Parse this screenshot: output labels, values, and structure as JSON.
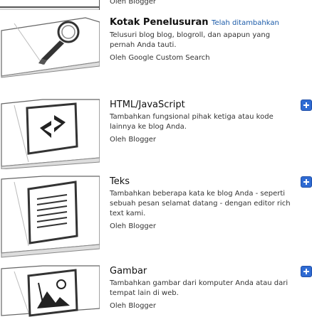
{
  "header": {
    "partial_text": "Oleh Blogger"
  },
  "gadgets": [
    {
      "title": "Kotak Penelusuran",
      "title_suffix": "Telah ditambahkan",
      "description": "Telusuri blog blog, blogroll, dan apapun yang pernah Anda tauti.",
      "byline": "Oleh Google Custom Search",
      "icon": "search-magnifier-icon",
      "added": true
    },
    {
      "title": "HTML/JavaScript",
      "description": "Tambahkan fungsional pihak ketiga atau kode lainnya ke blog Anda.",
      "byline": "Oleh Blogger",
      "icon": "code-brackets-icon",
      "added": false
    },
    {
      "title": "Teks",
      "description": "Tambahkan beberapa kata ke blog Anda - seperti sebuah pesan selamat datang - dengan editor rich text kami.",
      "byline": "Oleh Blogger",
      "icon": "text-lines-icon",
      "added": false
    },
    {
      "title": "Gambar",
      "description": "Tambahkan gambar dari komputer Anda atau dari tempat lain di web.",
      "byline": "Oleh Blogger",
      "icon": "image-icon",
      "added": false
    }
  ],
  "colors": {
    "accent_blue": "#2f6bd3",
    "title_suffix_blue": "#1a5aa8",
    "thumb_stroke": "#5a5a5a"
  }
}
